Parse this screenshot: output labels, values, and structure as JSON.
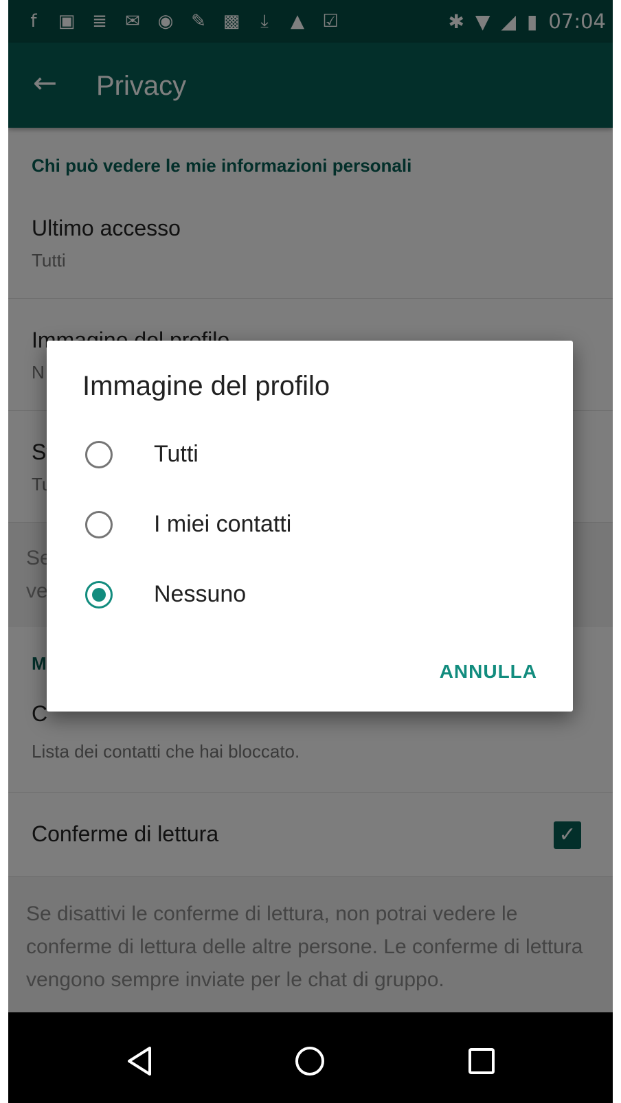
{
  "status_bar": {
    "left_icons": [
      "facebook-icon",
      "gallery-icon",
      "coins-icon",
      "mail-icon",
      "whatsapp-icon",
      "wrench-icon",
      "image-icon",
      "download-icon",
      "warning-icon",
      "clipboard-icon"
    ],
    "right_icons": [
      "bluetooth-icon",
      "wifi-icon",
      "signal-icon",
      "battery-icon"
    ],
    "time": "07:04"
  },
  "app_bar": {
    "title": "Privacy"
  },
  "settings": {
    "section1_header": "Chi può vedere le mie informazioni personali",
    "items": [
      {
        "title": "Ultimo accesso",
        "subtitle": "Tutti"
      },
      {
        "title": "Immagine del profilo",
        "subtitle": "N"
      },
      {
        "title": "St",
        "subtitle": "Tu"
      }
    ],
    "note1": "Se\nve",
    "section2_header": "M",
    "blocked": {
      "title": "C",
      "subtitle": "Lista dei contatti che hai bloccato."
    },
    "read_receipts": {
      "title": "Conferme di lettura",
      "checked": true
    },
    "note2": "Se disattivi le conferme di lettura, non potrai vedere le conferme di lettura delle altre persone. Le conferme di lettura vengono sempre inviate per le chat di gruppo."
  },
  "dialog": {
    "title": "Immagine del profilo",
    "options": [
      {
        "label": "Tutti",
        "selected": false
      },
      {
        "label": "I miei contatti",
        "selected": false
      },
      {
        "label": "Nessuno",
        "selected": true
      }
    ],
    "cancel_label": "ANNULLA"
  },
  "colors": {
    "primary_dark": "#054d44",
    "primary": "#075e54",
    "accent": "#128c7e"
  }
}
